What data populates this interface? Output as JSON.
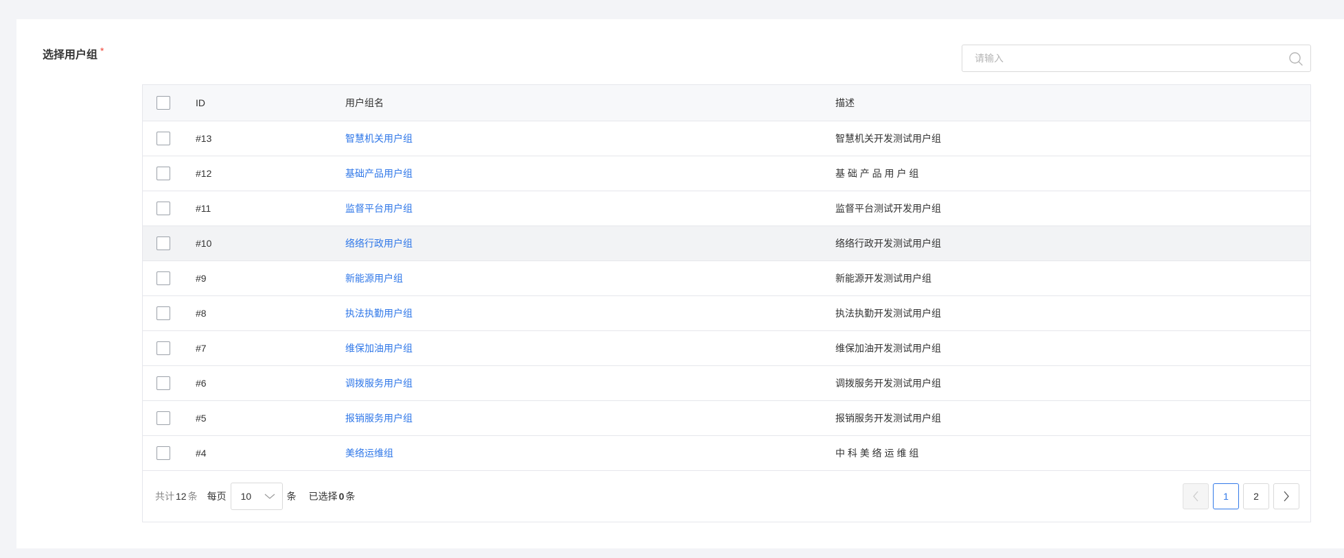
{
  "form": {
    "label": "选择用户组",
    "required_mark": "*"
  },
  "search": {
    "placeholder": "请输入",
    "value": "",
    "icon": "search-icon"
  },
  "table": {
    "headers": {
      "id": "ID",
      "name": "用户组名",
      "description": "描述"
    },
    "rows": [
      {
        "id": "#13",
        "name": "智慧机关用户组",
        "description": "智慧机关开发测试用户组"
      },
      {
        "id": "#12",
        "name": "基础产品用户组",
        "description": "基 础 产 品 用 户 组"
      },
      {
        "id": "#11",
        "name": "监督平台用户组",
        "description": "监督平台测试开发用户组"
      },
      {
        "id": "#10",
        "name": "络络行政用户组",
        "description": "络络行政开发测试用户组"
      },
      {
        "id": "#9",
        "name": "新能源用户组",
        "description": "新能源开发测试用户组"
      },
      {
        "id": "#8",
        "name": "执法执勤用户组",
        "description": "执法执勤开发测试用户组"
      },
      {
        "id": "#7",
        "name": "维保加油用户组",
        "description": "维保加油开发测试用户组"
      },
      {
        "id": "#6",
        "name": "调拨服务用户组",
        "description": "调拨服务开发测试用户组"
      },
      {
        "id": "#5",
        "name": "报销服务用户组",
        "description": "报销服务开发测试用户组"
      },
      {
        "id": "#4",
        "name": "美络运维组",
        "description": "中 科 美 络 运 维 组"
      }
    ]
  },
  "footer": {
    "total_prefix": "共计",
    "total_count": "12",
    "total_suffix": "条",
    "per_page_label": "每页",
    "page_size": "10",
    "per_page_suffix": "条",
    "selected_prefix": "已选择",
    "selected_count": "0",
    "selected_suffix": "条"
  },
  "pagination": {
    "pages": [
      "1",
      "2"
    ],
    "current": "1"
  },
  "colors": {
    "link": "#2f77e8",
    "required": "#f04134",
    "hover_row": "#f2f3f5"
  }
}
